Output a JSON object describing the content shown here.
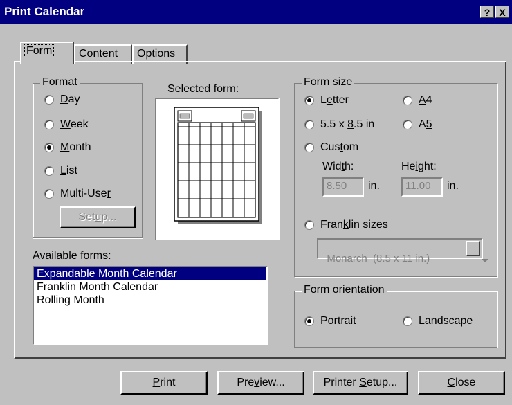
{
  "window": {
    "title": "Print Calendar",
    "help_glyph": "?",
    "close_glyph": "X"
  },
  "tabs": [
    {
      "label": "Form",
      "active": true
    },
    {
      "label": "Content",
      "active": false
    },
    {
      "label": "Options",
      "active": false
    }
  ],
  "format": {
    "legend": "Format",
    "options": [
      {
        "pre": "",
        "key": "D",
        "post": "ay",
        "selected": false
      },
      {
        "pre": "",
        "key": "W",
        "post": "eek",
        "selected": false
      },
      {
        "pre": "",
        "key": "M",
        "post": "onth",
        "selected": true
      },
      {
        "pre": "",
        "key": "L",
        "post": "ist",
        "selected": false
      },
      {
        "pre": "Multi-Use",
        "key": "r",
        "post": "",
        "selected": false
      }
    ],
    "setup_button": {
      "pre": "Set",
      "key": "u",
      "post": "p..."
    }
  },
  "selected_form": {
    "label": "Selected form:"
  },
  "available_forms": {
    "label_pre": "Available ",
    "label_key": "f",
    "label_post": "orms:",
    "items": [
      "Expandable Month Calendar",
      "Franklin Month Calendar",
      "Rolling Month"
    ],
    "selected_index": 0
  },
  "form_size": {
    "legend": "Form size",
    "letter": {
      "pre": "L",
      "key": "e",
      "post": "tter",
      "selected": true
    },
    "a4": {
      "pre": "",
      "key": "A",
      "post": "4",
      "selected": false
    },
    "half": {
      "pre": "5.5 x ",
      "key": "8",
      "post": ".5 in",
      "selected": false
    },
    "a5": {
      "pre": "A",
      "key": "5",
      "post": "",
      "selected": false
    },
    "custom": {
      "pre": "Cus",
      "key": "t",
      "post": "om",
      "selected": false
    },
    "width_label": {
      "pre": "Wid",
      "key": "t",
      "post": "h:"
    },
    "height_label": {
      "pre": "He",
      "key": "i",
      "post": "ght:"
    },
    "width_value": "8.50",
    "height_value": "11.00",
    "unit": "in.",
    "franklin": {
      "pre": "Fran",
      "key": "k",
      "post": "lin sizes",
      "selected": false
    },
    "franklin_value": "Monarch  (8.5 x 11 in.)"
  },
  "orientation": {
    "legend": "Form orientation",
    "portrait": {
      "pre": "P",
      "key": "o",
      "post": "rtrait",
      "selected": true
    },
    "landscape": {
      "pre": "La",
      "key": "n",
      "post": "dscape",
      "selected": false
    }
  },
  "buttons": {
    "print": {
      "pre": "",
      "key": "P",
      "post": "rint"
    },
    "preview": {
      "pre": "Pre",
      "key": "v",
      "post": "iew..."
    },
    "printer_setup": {
      "pre": "Printer ",
      "key": "S",
      "post": "etup..."
    },
    "close": {
      "pre": "",
      "key": "C",
      "post": "lose"
    }
  }
}
